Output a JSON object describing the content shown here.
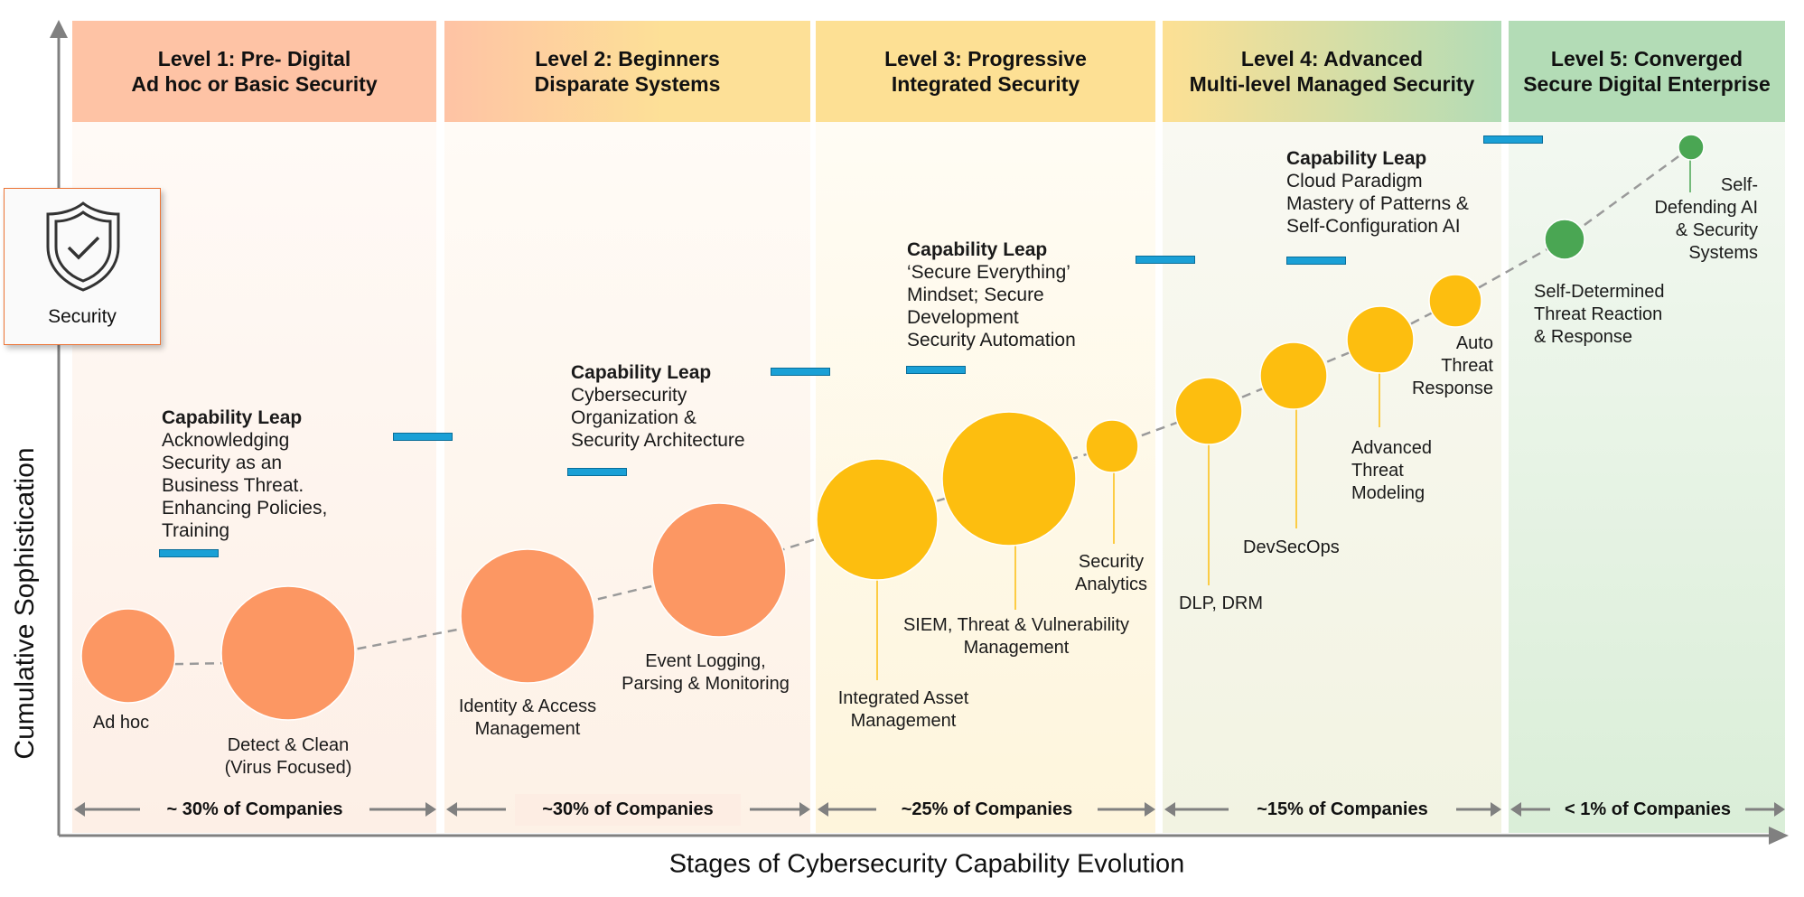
{
  "axes": {
    "y_label": "Cumulative Sophistication",
    "x_label": "Stages of Cybersecurity Capability Evolution"
  },
  "badge": {
    "icon": "shield-check-icon",
    "label": "Security"
  },
  "colors": {
    "orange": "#fc9763",
    "yellow": "#fdbe0f",
    "green": "#4aa653",
    "leap_bar": "#1aa0d6",
    "badge_border": "#ec7435"
  },
  "levels": [
    {
      "title": "Level 1: Pre- Digital",
      "subtitle": "Ad hoc or Basic Security",
      "share": "~ 30% of Companies"
    },
    {
      "title": "Level 2: Beginners",
      "subtitle": "Disparate Systems",
      "share": "~30% of Companies"
    },
    {
      "title": "Level 3: Progressive",
      "subtitle": "Integrated Security",
      "share": "~25% of Companies"
    },
    {
      "title": "Level 4: Advanced",
      "subtitle": "Multi-level Managed Security",
      "share": "~15% of Companies"
    },
    {
      "title": "Level 5: Converged",
      "subtitle": "Secure Digital Enterprise",
      "share": "< 1% of Companies"
    }
  ],
  "capability_leaps": [
    {
      "title": "Capability Leap",
      "text": "Acknowledging\nSecurity as an\nBusiness Threat.\nEnhancing Policies,\nTraining"
    },
    {
      "title": "Capability Leap",
      "text": "Cybersecurity\nOrganization &\nSecurity Architecture"
    },
    {
      "title": "Capability Leap",
      "text": "‘Secure Everything’\nMindset; Secure\nDevelopment\nSecurity Automation"
    },
    {
      "title": "Capability Leap",
      "text": "Cloud Paradigm\nMastery of Patterns &\nSelf-Configuration AI"
    }
  ],
  "capabilities": [
    {
      "label": "Ad hoc",
      "level": 1,
      "color": "orange"
    },
    {
      "label": "Detect & Clean\n(Virus Focused)",
      "level": 1,
      "color": "orange"
    },
    {
      "label": "Identity & Access\nManagement",
      "level": 2,
      "color": "orange"
    },
    {
      "label": "Event Logging,\nParsing & Monitoring",
      "level": 2,
      "color": "orange"
    },
    {
      "label": "Integrated Asset\nManagement",
      "level": 3,
      "color": "yellow"
    },
    {
      "label": "SIEM, Threat & Vulnerability\nManagement",
      "level": 3,
      "color": "yellow"
    },
    {
      "label": "Security\nAnalytics",
      "level": 3,
      "color": "yellow"
    },
    {
      "label": "DLP, DRM",
      "level": 4,
      "color": "yellow"
    },
    {
      "label": "DevSecOps",
      "level": 4,
      "color": "yellow"
    },
    {
      "label": "Advanced\nThreat\nModeling",
      "level": 4,
      "color": "yellow"
    },
    {
      "label": "Auto\nThreat\nResponse",
      "level": 4,
      "color": "yellow"
    },
    {
      "label": "Self-Determined\nThreat Reaction\n& Response",
      "level": 5,
      "color": "green"
    },
    {
      "label": "Self-\nDefending AI\n& Security\nSystems",
      "level": 5,
      "color": "green"
    }
  ]
}
